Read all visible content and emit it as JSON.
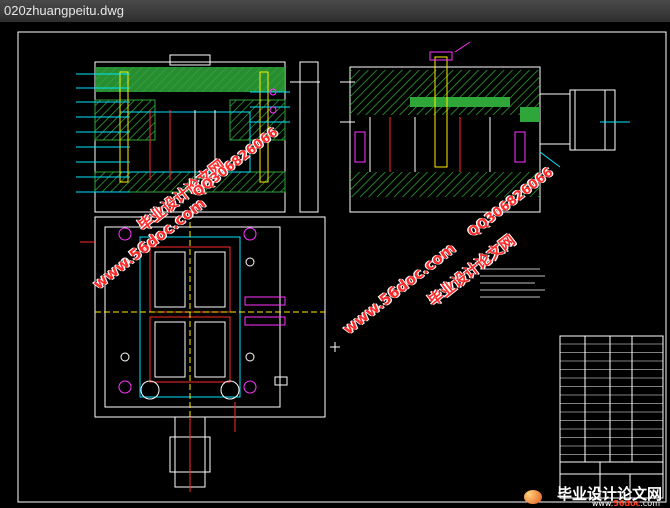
{
  "window": {
    "title": "020zhuangpeitu.dwg"
  },
  "watermarks": {
    "site_text": "www.56doc.com",
    "qq_text": "QQ306826066",
    "brand_cn": "毕业设计论文网"
  },
  "logo": {
    "cn": "毕业设计论文网",
    "url_prefix": "www.",
    "url_accent": "56doc",
    "url_suffix": ".com"
  },
  "colors": {
    "background": "#000000",
    "frame": "#ffffff",
    "hatch": "#2fa63a",
    "hole": "#ff33ff",
    "cyan": "#00e5ff",
    "red": "#ff2a2a",
    "yellow": "#ffee00"
  }
}
